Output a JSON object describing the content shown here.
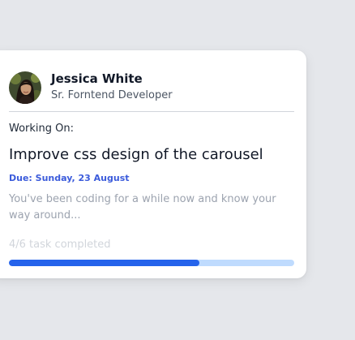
{
  "user": {
    "name": "Jessica White",
    "role": "Sr. Forntend Developer",
    "avatar_icon": "user-avatar-photo"
  },
  "task": {
    "working_label": "Working On:",
    "title": "Improve css design of the carousel",
    "due": "Due: Sunday, 23 August",
    "description": "You've been coding for a while now and know your way around..."
  },
  "progress": {
    "label": "4/6 task completed",
    "completed": 4,
    "total": 6,
    "fraction": 0.667
  },
  "colors": {
    "background": "#e5e7eb",
    "card": "#ffffff",
    "accent": "#2563eb",
    "due_text": "#3b5bdb",
    "track": "#bfdbfe"
  }
}
